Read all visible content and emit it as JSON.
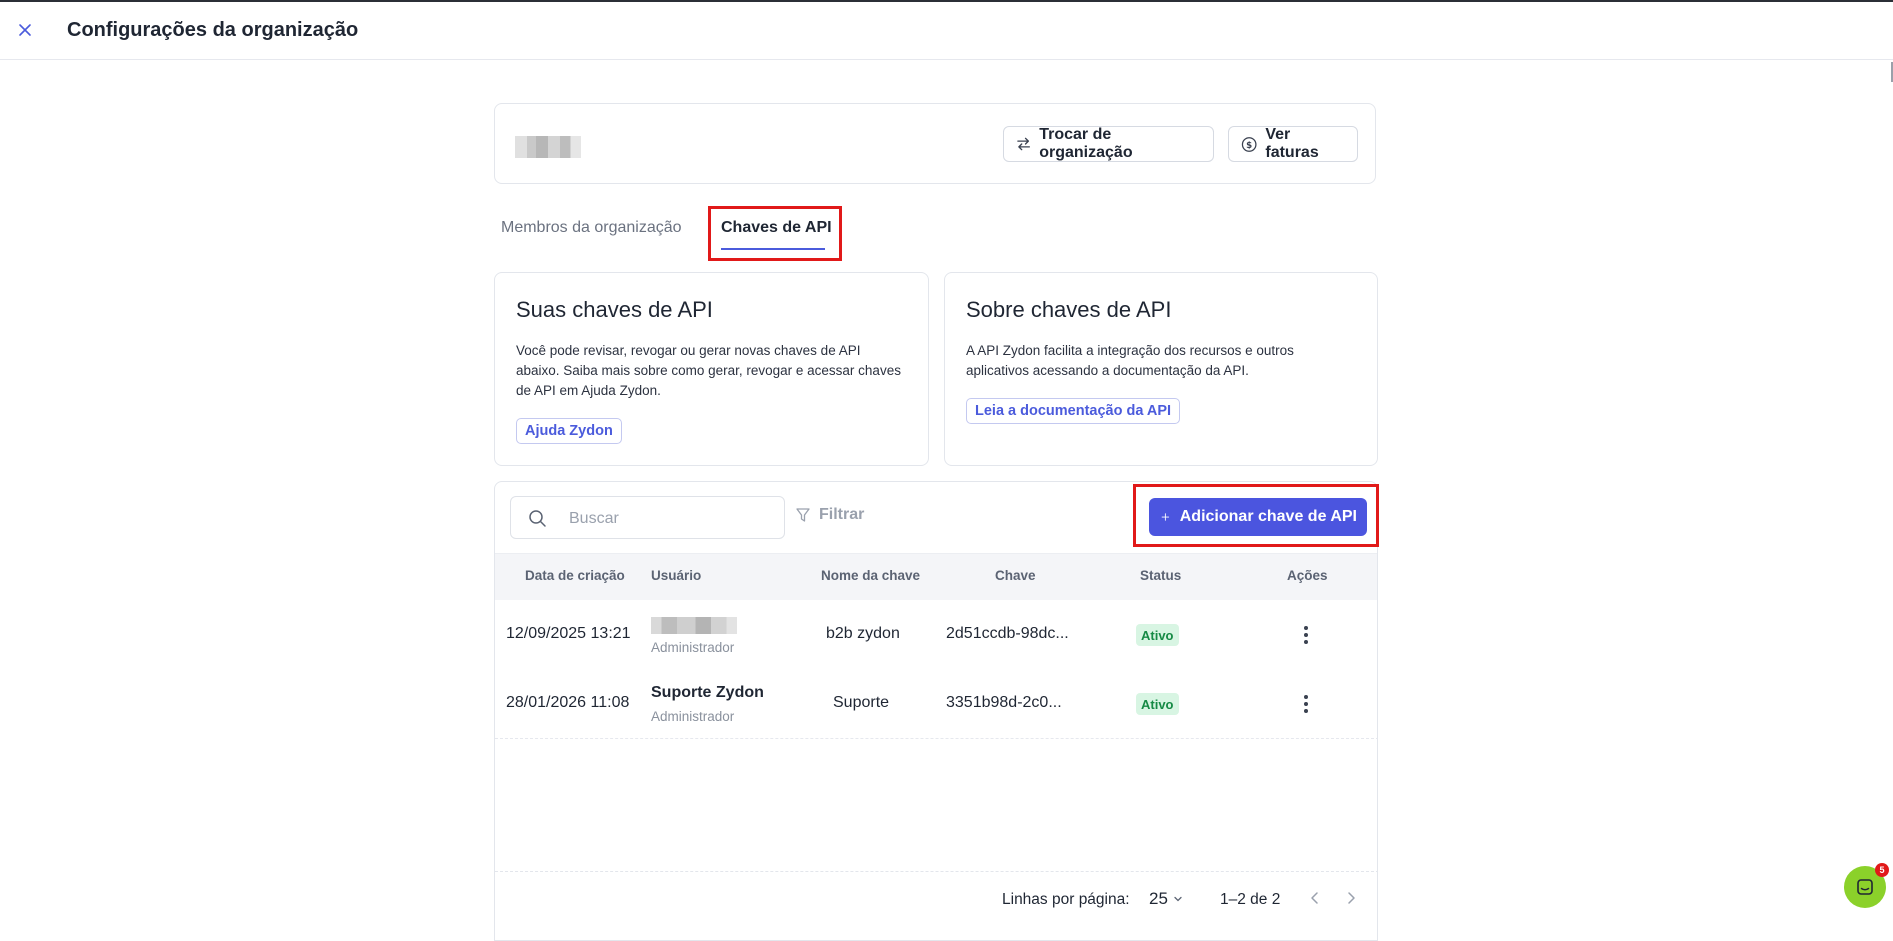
{
  "header": {
    "title": "Configurações da organização"
  },
  "org": {
    "switch_label": "Trocar de organização",
    "invoices_label": "Ver faturas"
  },
  "tabs": [
    {
      "label": "Membros da organização"
    },
    {
      "label": "Chaves de API"
    }
  ],
  "cards": {
    "yours": {
      "title": "Suas chaves de API",
      "text": "Você pode revisar, revogar ou gerar novas chaves de API abaixo. Saiba mais sobre como gerar, revogar e acessar chaves de API em Ajuda Zydon.",
      "link": "Ajuda Zydon"
    },
    "about": {
      "title": "Sobre chaves de API",
      "text": "A API Zydon facilita a integração dos recursos e outros aplicativos acessando a documentação da API.",
      "link": "Leia a documentação da API"
    }
  },
  "toolbar": {
    "search_placeholder": "Buscar",
    "filter_label": "Filtrar",
    "add_label": "Adicionar chave de API"
  },
  "table": {
    "columns": [
      "Data de criação",
      "Usuário",
      "Nome da chave",
      "Chave",
      "Status",
      "Ações"
    ],
    "rows": [
      {
        "date": "12/09/2025 13:21",
        "user": "",
        "role": "Administrador",
        "key_name": "b2b zydon",
        "key": "2d51ccdb-98dc...",
        "status": "Ativo"
      },
      {
        "date": "28/01/2026 11:08",
        "user": "Suporte Zydon",
        "role": "Administrador",
        "key_name": "Suporte",
        "key": "3351b98d-2c0...",
        "status": "Ativo"
      }
    ]
  },
  "pagination": {
    "rows_label": "Linhas por página:",
    "rows_value": "25",
    "range": "1–2 de 2"
  },
  "chat": {
    "badge": "5"
  },
  "colors": {
    "accent": "#4b55df",
    "highlight": "#e11919",
    "status_bg": "#d8f5e3",
    "status_text": "#168a45",
    "chat": "#8bd12a"
  },
  "icons": [
    "close-icon",
    "swap-icon",
    "dollar-circle-icon",
    "search-icon",
    "filter-icon",
    "plus-icon",
    "kebab-icon",
    "chevron-down-icon",
    "chevron-left-icon",
    "chevron-right-icon",
    "chat-icon"
  ]
}
